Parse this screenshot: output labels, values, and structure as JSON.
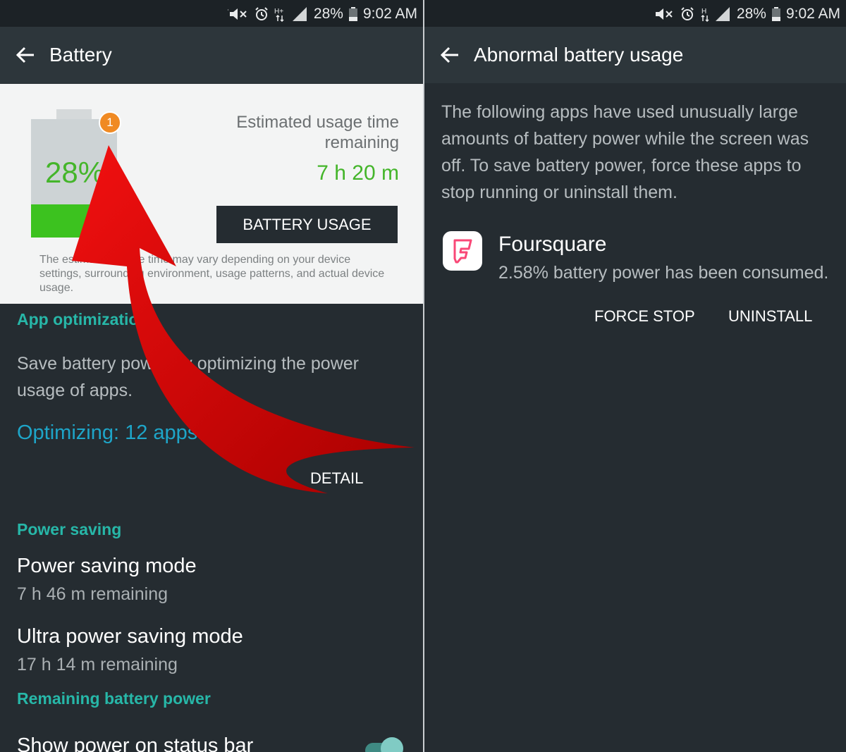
{
  "status_bar": {
    "battery_percent": "28%",
    "time": "9:02 AM",
    "icons": [
      "mute-icon",
      "alarm-icon",
      "hplus-network-icon",
      "signal-icon",
      "battery-icon"
    ]
  },
  "left": {
    "appbar": {
      "title": "Battery",
      "back_icon": "arrow-left-icon"
    },
    "battery_card": {
      "level_percent": 28,
      "percent_label": "28%",
      "badge_count": "1",
      "estimated_label": "Estimated usage time remaining",
      "estimated_value": "7 h 20 m",
      "usage_button": "BATTERY USAGE",
      "disclaimer": "The estimated usage time may vary depending on your device settings, surrounding environment, usage patterns, and actual device usage."
    },
    "app_optimization": {
      "header": "App optimization",
      "description": "Save battery power by optimizing the power usage of apps.",
      "status": "Optimizing: 12 apps",
      "detail_action": "DETAIL"
    },
    "power_saving": {
      "header": "Power saving",
      "items": [
        {
          "title": "Power saving mode",
          "subtitle": "7 h 46 m remaining"
        },
        {
          "title": "Ultra power saving mode",
          "subtitle": "17 h 14 m remaining"
        }
      ]
    },
    "remaining_power": {
      "header": "Remaining battery power",
      "show_on_status_bar": "Show power on status bar",
      "toggle_on": true
    },
    "overlay": {
      "arrow_color": "#d90000"
    }
  },
  "right": {
    "appbar": {
      "title": "Abnormal battery usage",
      "back_icon": "arrow-left-icon"
    },
    "description": "The following apps have used unusually large amounts of battery power while the screen was off. To save battery power, force these apps to stop running or uninstall them.",
    "app": {
      "name": "Foursquare",
      "consumed": "2.58% battery power has been consumed.",
      "icon": "foursquare-icon",
      "icon_color": "#f94877"
    },
    "actions": {
      "force_stop": "FORCE STOP",
      "uninstall": "UNINSTALL"
    }
  },
  "colors": {
    "accent_teal": "#27b7a8",
    "accent_blue": "#1ea5c8",
    "battery_green": "#3cc21f",
    "badge_orange": "#f08a23"
  }
}
